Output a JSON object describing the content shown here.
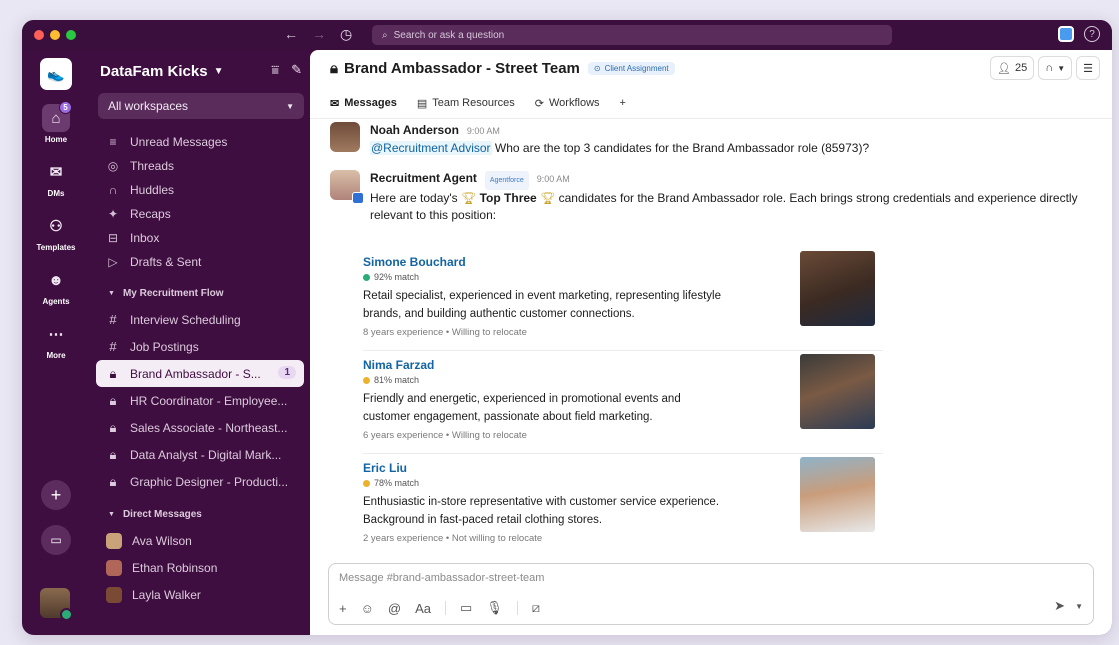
{
  "topbar": {
    "search_placeholder": "Search or ask a question"
  },
  "workspace": {
    "name": "DataFam Kicks",
    "filter_label": "All workspaces"
  },
  "rail": {
    "items": [
      {
        "label": "Home",
        "icon": "home-icon",
        "badge": "5"
      },
      {
        "label": "DMs",
        "icon": "dm-icon"
      },
      {
        "label": "Templates",
        "icon": "templates-icon"
      },
      {
        "label": "Agents",
        "icon": "agents-icon"
      },
      {
        "label": "More",
        "icon": "more-icon"
      }
    ]
  },
  "sidebar": {
    "nav": [
      {
        "label": "Unread Messages",
        "icon": "unread-icon"
      },
      {
        "label": "Threads",
        "icon": "threads-icon"
      },
      {
        "label": "Huddles",
        "icon": "headphones-icon"
      },
      {
        "label": "Recaps",
        "icon": "recaps-icon"
      },
      {
        "label": "Inbox",
        "icon": "inbox-icon"
      },
      {
        "label": "Drafts & Sent",
        "icon": "send-icon"
      }
    ],
    "section_flow": "My Recruitment Flow",
    "channels": [
      {
        "label": "Interview Scheduling",
        "icon": "hash-icon"
      },
      {
        "label": "Job Postings",
        "icon": "hash-icon"
      },
      {
        "label": "Brand Ambassador - S...",
        "icon": "lock-icon",
        "count": "1"
      },
      {
        "label": "HR Coordinator - Employee...",
        "icon": "lock-icon"
      },
      {
        "label": "Sales Associate - Northeast...",
        "icon": "lock-icon"
      },
      {
        "label": "Data Analyst - Digital Mark...",
        "icon": "lock-icon"
      },
      {
        "label": "Graphic Designer - Producti...",
        "icon": "lock-icon"
      }
    ],
    "section_dm": "Direct Messages",
    "dms": [
      {
        "label": "Ava Wilson"
      },
      {
        "label": "Ethan Robinson"
      },
      {
        "label": "Layla Walker"
      }
    ]
  },
  "channel": {
    "title": "Brand Ambassador - Street Team",
    "tag": "Client Assignment",
    "member_count": "25",
    "tabs": [
      {
        "label": "Messages"
      },
      {
        "label": "Team Resources"
      },
      {
        "label": "Workflows"
      }
    ]
  },
  "messages": [
    {
      "author": "Noah Anderson",
      "time": "9:00 AM",
      "mention": "@Recruitment Advisor",
      "text": " Who are the top 3 candidates for the Brand Ambassador role (85973)?"
    },
    {
      "author": "Recruitment Agent",
      "app_tag": "Agentforce",
      "time": "9:00 AM",
      "text_pre": "Here are today's ",
      "text_bold": "Top Three",
      "text_post": " candidates for the Brand Ambassador role. Each brings strong credentials and experience directly relevant to this position:"
    }
  ],
  "candidates": [
    {
      "name": "Simone Bouchard",
      "match": "92% match",
      "match_color": "#2bac76",
      "desc": "Retail specialist, experienced in event marketing, representing lifestyle brands, and building authentic customer connections.",
      "meta": "8 years experience  •  Willing to relocate"
    },
    {
      "name": "Nima Farzad",
      "match": "81% match",
      "match_color": "#ecb22e",
      "desc": "Friendly and energetic, experienced in promotional events and customer engagement, passionate about field marketing.",
      "meta": "6 years experience  •  Willing to relocate"
    },
    {
      "name": "Eric Liu",
      "match": "78% match",
      "match_color": "#ecb22e",
      "desc": "Enthusiastic in-store representative with customer service experience. Background in fast-paced retail clothing stores.",
      "meta": "2 years experience  •  Not willing to relocate"
    }
  ],
  "composer": {
    "placeholder": "Message #brand-ambassador-street-team",
    "format_label": "Aa"
  },
  "colors": {
    "sidebar_bg": "#3f0e40",
    "link": "#1264a3"
  }
}
